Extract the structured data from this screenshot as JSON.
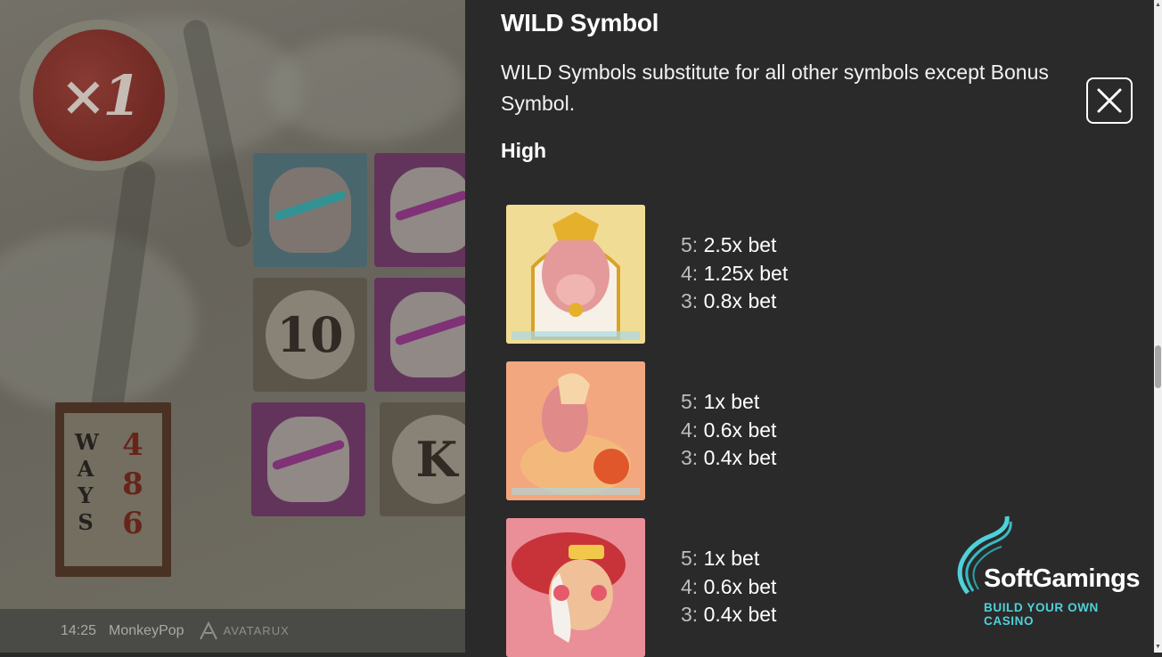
{
  "game": {
    "multiplier": "×1",
    "ways_label": "WAYS",
    "ways_count": "486",
    "tile_letters": [
      "10",
      "K"
    ],
    "status": {
      "time": "14:25",
      "game_name": "MonkeyPop",
      "provider": "AVATARUX"
    }
  },
  "paytable": {
    "wild_title": "WILD Symbol",
    "wild_description": "WILD Symbols substitute for all other symbols except Bonus Symbol.",
    "section_title": "High",
    "symbols": [
      {
        "pays": [
          {
            "count": "5:",
            "value": "2.5x bet"
          },
          {
            "count": "4:",
            "value": "1.25x bet"
          },
          {
            "count": "3:",
            "value": "0.8x bet"
          }
        ]
      },
      {
        "pays": [
          {
            "count": "5:",
            "value": "1x bet"
          },
          {
            "count": "4:",
            "value": "0.6x bet"
          },
          {
            "count": "3:",
            "value": "0.4x bet"
          }
        ]
      },
      {
        "pays": [
          {
            "count": "5:",
            "value": "1x bet"
          },
          {
            "count": "4:",
            "value": "0.6x bet"
          },
          {
            "count": "3:",
            "value": "0.4x bet"
          }
        ]
      }
    ]
  },
  "close_icon": "close-icon",
  "brand": {
    "name": "SoftGamings",
    "tagline": "BUILD YOUR OWN CASINO"
  },
  "colors": {
    "panel_bg": "#2a2a2a",
    "brand_accent": "#4fd1d9"
  }
}
